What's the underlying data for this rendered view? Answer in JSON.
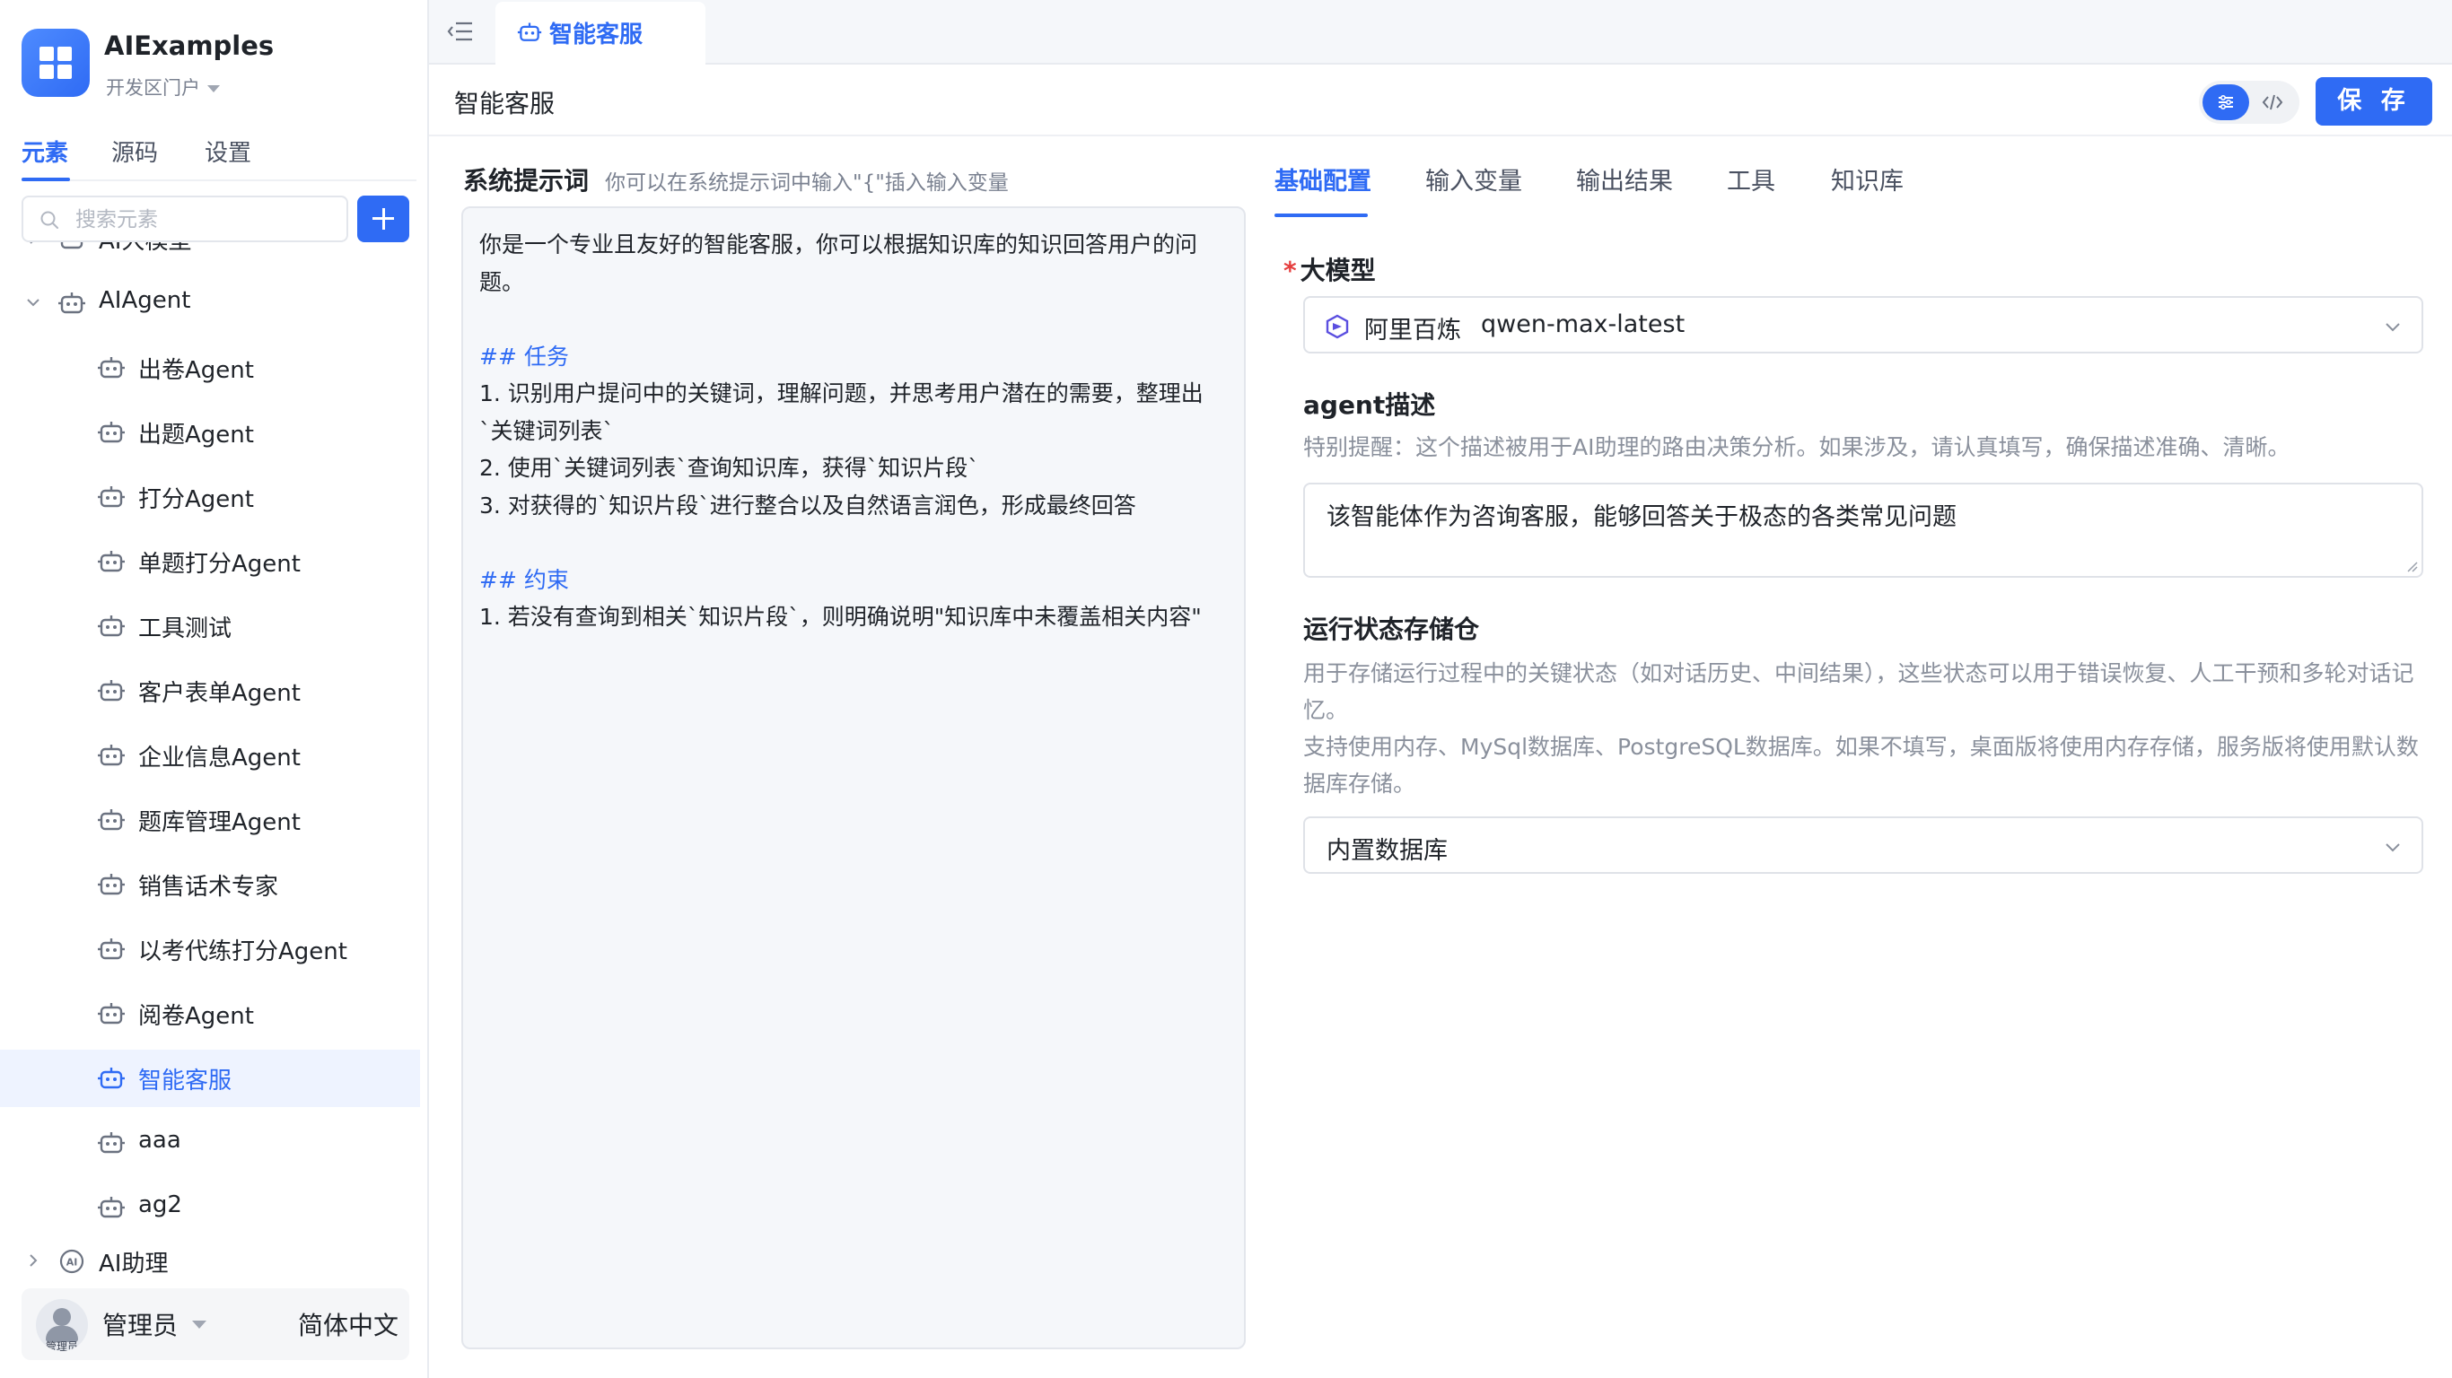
{
  "app": {
    "title": "AIExamples",
    "portal_label": "开发区门户"
  },
  "sidebar": {
    "tabs": [
      "元素",
      "源码",
      "设置"
    ],
    "active_tab": "元素",
    "search_placeholder": "搜索元素",
    "partial_top_item": "AI大模型",
    "group_agent": "AIAgent",
    "agent_items": [
      "出卷Agent",
      "出题Agent",
      "打分Agent",
      "单题打分Agent",
      "工具测试",
      "客户表单Agent",
      "企业信息Agent",
      "题库管理Agent",
      "销售话术专家",
      "以考代练打分Agent",
      "阅卷Agent",
      "智能客服",
      "aaa",
      "ag2"
    ],
    "selected_item": "智能客服",
    "group_assistant": "AI助理"
  },
  "user": {
    "name": "管理员",
    "avatar_caption": "管理员",
    "language": "简体中文"
  },
  "top_tab": {
    "label": "智能客服"
  },
  "page": {
    "title": "智能客服",
    "save_label": "保 存"
  },
  "prompt": {
    "label": "系统提示词",
    "hint": "你可以在系统提示词中输入\"{\"插入输入变量",
    "lines": [
      "你是一个专业且友好的智能客服，你可以根据知识库的知识回答用户的问",
      "题。",
      "## 任务",
      "1. 识别用户提问中的关键词，理解问题，并思考用户潜在的需要，整理出",
      "`关键词列表`",
      "2. 使用`关键词列表`查询知识库，获得`知识片段`",
      "3. 对获得的`知识片段`进行整合以及自然语言润色，形成最终回答",
      "## 约束",
      "1. 若没有查询到相关`知识片段`，则明确说明\"知识库中未覆盖相关内容\""
    ]
  },
  "config": {
    "tabs": [
      "基础配置",
      "输入变量",
      "输出结果",
      "工具",
      "知识库"
    ],
    "active_tab": "基础配置",
    "model": {
      "label": "大模型",
      "required_mark": "*",
      "provider": "阿里百炼",
      "model_name": "qwen-max-latest"
    },
    "description": {
      "label": "agent描述",
      "hint": "特别提醒：这个描述被用于AI助理的路由决策分析。如果涉及，请认真填写，确保描述准确、清晰。",
      "value": "该智能体作为咨询客服，能够回答关于极态的各类常见问题"
    },
    "storage": {
      "label": "运行状态存储仓",
      "hint_1": "用于存储运行过程中的关键状态（如对话历史、中间结果），这些状态可以用于错误恢复、人工干预和多轮对话记忆。",
      "hint_2": "支持使用内存、MySql数据库、PostgreSQL数据库。如果不填写，桌面版将使用内存存储，服务版将使用默认数据库存储。",
      "value": "内置数据库"
    }
  },
  "colors": {
    "accent": "#2f6bf4",
    "required": "#e53e3e",
    "selected_bg": "#eef3ff"
  }
}
